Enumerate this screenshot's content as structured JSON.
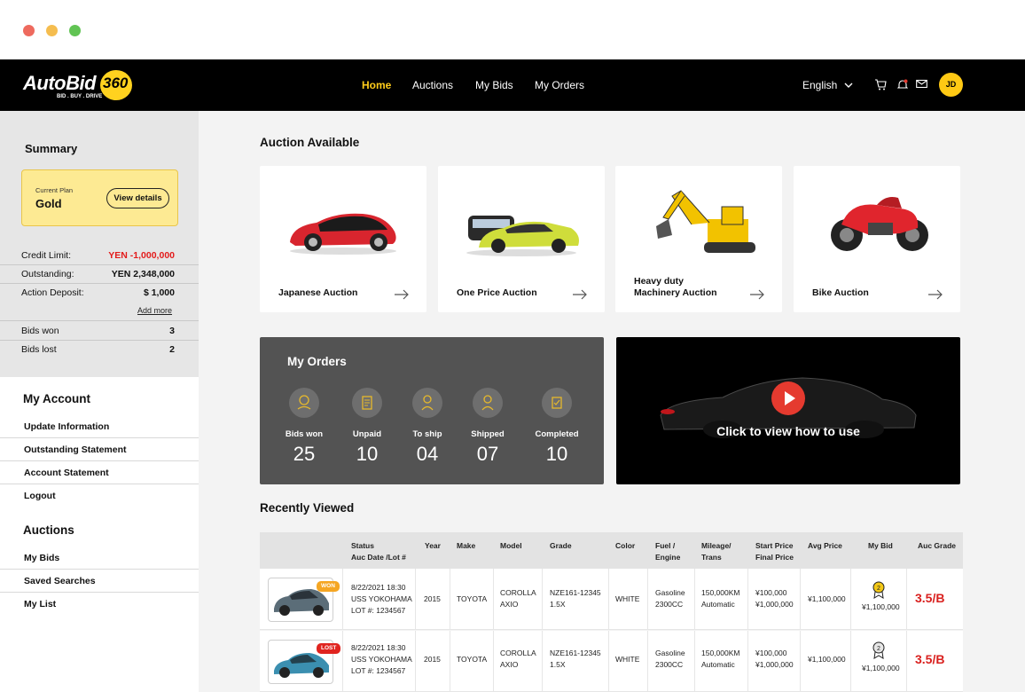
{
  "window": {
    "controls": [
      "close",
      "minimize",
      "maximize"
    ]
  },
  "brand": {
    "name": "AutoBid",
    "badge": "360",
    "tagline": "BID . BUY . DRIVE",
    "accent": "#ffcc1a"
  },
  "nav": {
    "items": [
      {
        "label": "Home",
        "active": true
      },
      {
        "label": "Auctions",
        "active": false
      },
      {
        "label": "My Bids",
        "active": false
      },
      {
        "label": "My Orders",
        "active": false
      }
    ],
    "language": "English",
    "avatar_initials": "JD"
  },
  "summary": {
    "title": "Summary",
    "plan_label": "Current Plan",
    "plan_value": "Gold",
    "view_details": "View details",
    "rows": [
      {
        "key": "Credit Limit:",
        "value": "YEN -1,000,000"
      },
      {
        "key": "Outstanding:",
        "value": "YEN 2,348,000"
      },
      {
        "key": "Action Deposit:",
        "value": "$ 1,000"
      }
    ],
    "add_more": "Add more",
    "bids": [
      {
        "key": "Bids won",
        "value": "3"
      },
      {
        "key": "Bids lost",
        "value": "2"
      }
    ]
  },
  "account": {
    "title": "My Account",
    "links": [
      "Update Information",
      "Outstanding Statement",
      "Account Statement",
      "Logout"
    ]
  },
  "auctions_menu": {
    "title": "Auctions",
    "links": [
      "My Bids",
      "Saved Searches",
      "My List"
    ]
  },
  "auction_available": {
    "title": "Auction Available",
    "cards": [
      {
        "label": "Japanese Auction",
        "icon": "sports-car-icon"
      },
      {
        "label": "One Price Auction",
        "icon": "cars-group-icon"
      },
      {
        "label": "Heavy duty\nMachinery Auction",
        "icon": "excavator-icon"
      },
      {
        "label": "Bike Auction",
        "icon": "motorbike-icon"
      }
    ]
  },
  "orders": {
    "title": "My Orders",
    "items": [
      {
        "label": "Bids won",
        "value": "25"
      },
      {
        "label": "Unpaid",
        "value": "10"
      },
      {
        "label": "To ship",
        "value": "04"
      },
      {
        "label": "Shipped",
        "value": "07"
      },
      {
        "label": "Completed",
        "value": "10"
      }
    ]
  },
  "video": {
    "label": "Click to view how to use"
  },
  "recently_viewed": {
    "title": "Recently Viewed",
    "headers": {
      "status": "Status",
      "status2": "Auc Date /Lot #",
      "year": "Year",
      "make": "Make",
      "model": "Model",
      "grade": "Grade",
      "color": "Color",
      "fuel": "Fuel /",
      "fuel2": "Engine",
      "mileage": "Mileage/",
      "mileage2": "Trans",
      "start": "Start Price",
      "start2": "Final Price",
      "avg": "Avg Price",
      "mybid": "My Bid",
      "aucgrade": "Auc Grade"
    },
    "rows": [
      {
        "badge": "WON",
        "badge_color": "#f5a623",
        "date": "8/22/2021 18:30",
        "venue": "USS YOKOHAMA",
        "lot": "LOT #: 1234567",
        "year": "2015",
        "make": "TOYOTA",
        "model1": "COROLLA",
        "model2": "AXIO",
        "grade1": "NZE161-12345",
        "grade2": "1.5X",
        "color": "WHITE",
        "fuel1": "Gasoline",
        "fuel2": "2300CC",
        "mile1": "150,000KM",
        "mile2": "Automatic",
        "start": "¥100,000",
        "final": "¥1,000,000",
        "avg": "¥1,100,000",
        "mybid": "¥1,100,000",
        "rank": "2",
        "medal": "gold",
        "aucgrade": "3.5/B",
        "car_color": "#5b6d78"
      },
      {
        "badge": "LOST",
        "badge_color": "#e0241f",
        "date": "8/22/2021 18:30",
        "venue": "USS YOKOHAMA",
        "lot": "LOT #: 1234567",
        "year": "2015",
        "make": "TOYOTA",
        "model1": "COROLLA",
        "model2": "AXIO",
        "grade1": "NZE161-12345",
        "grade2": "1.5X",
        "color": "WHITE",
        "fuel1": "Gasoline",
        "fuel2": "2300CC",
        "mile1": "150,000KM",
        "mile2": "Automatic",
        "start": "¥100,000",
        "final": "¥1,000,000",
        "avg": "¥1,100,000",
        "mybid": "¥1,100,000",
        "rank": "2",
        "medal": "gray",
        "aucgrade": "3.5/B",
        "car_color": "#3b8fb0"
      }
    ]
  }
}
